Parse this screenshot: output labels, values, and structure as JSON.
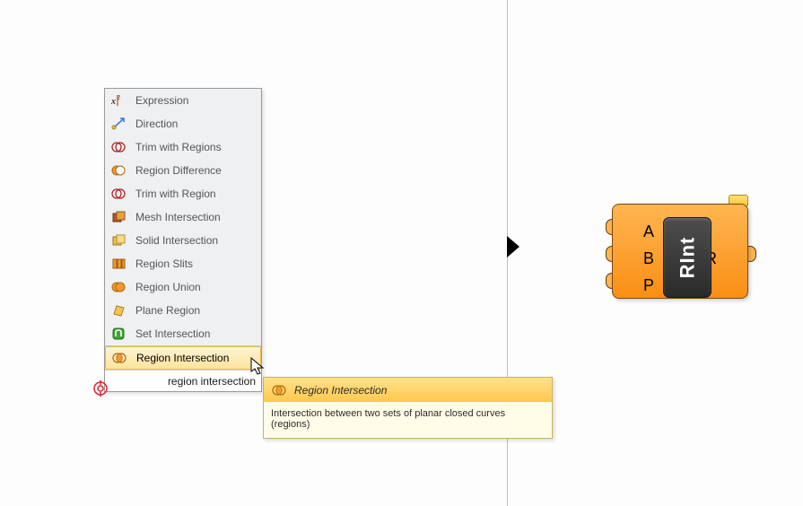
{
  "menu": {
    "items": [
      {
        "label": "Expression"
      },
      {
        "label": "Direction"
      },
      {
        "label": "Trim with Regions"
      },
      {
        "label": "Region Difference"
      },
      {
        "label": "Trim with Region"
      },
      {
        "label": "Mesh Intersection"
      },
      {
        "label": "Solid Intersection"
      },
      {
        "label": "Region Slits"
      },
      {
        "label": "Region Union"
      },
      {
        "label": "Plane Region"
      },
      {
        "label": "Set Intersection"
      },
      {
        "label": "Region Intersection"
      }
    ],
    "input_value": "region intersection"
  },
  "tooltip": {
    "title": "Region Intersection",
    "body": "Intersection between two sets of planar closed curves (regions)"
  },
  "node": {
    "core": "RInt",
    "inputs": [
      "A",
      "B",
      "P"
    ],
    "output": "R"
  }
}
